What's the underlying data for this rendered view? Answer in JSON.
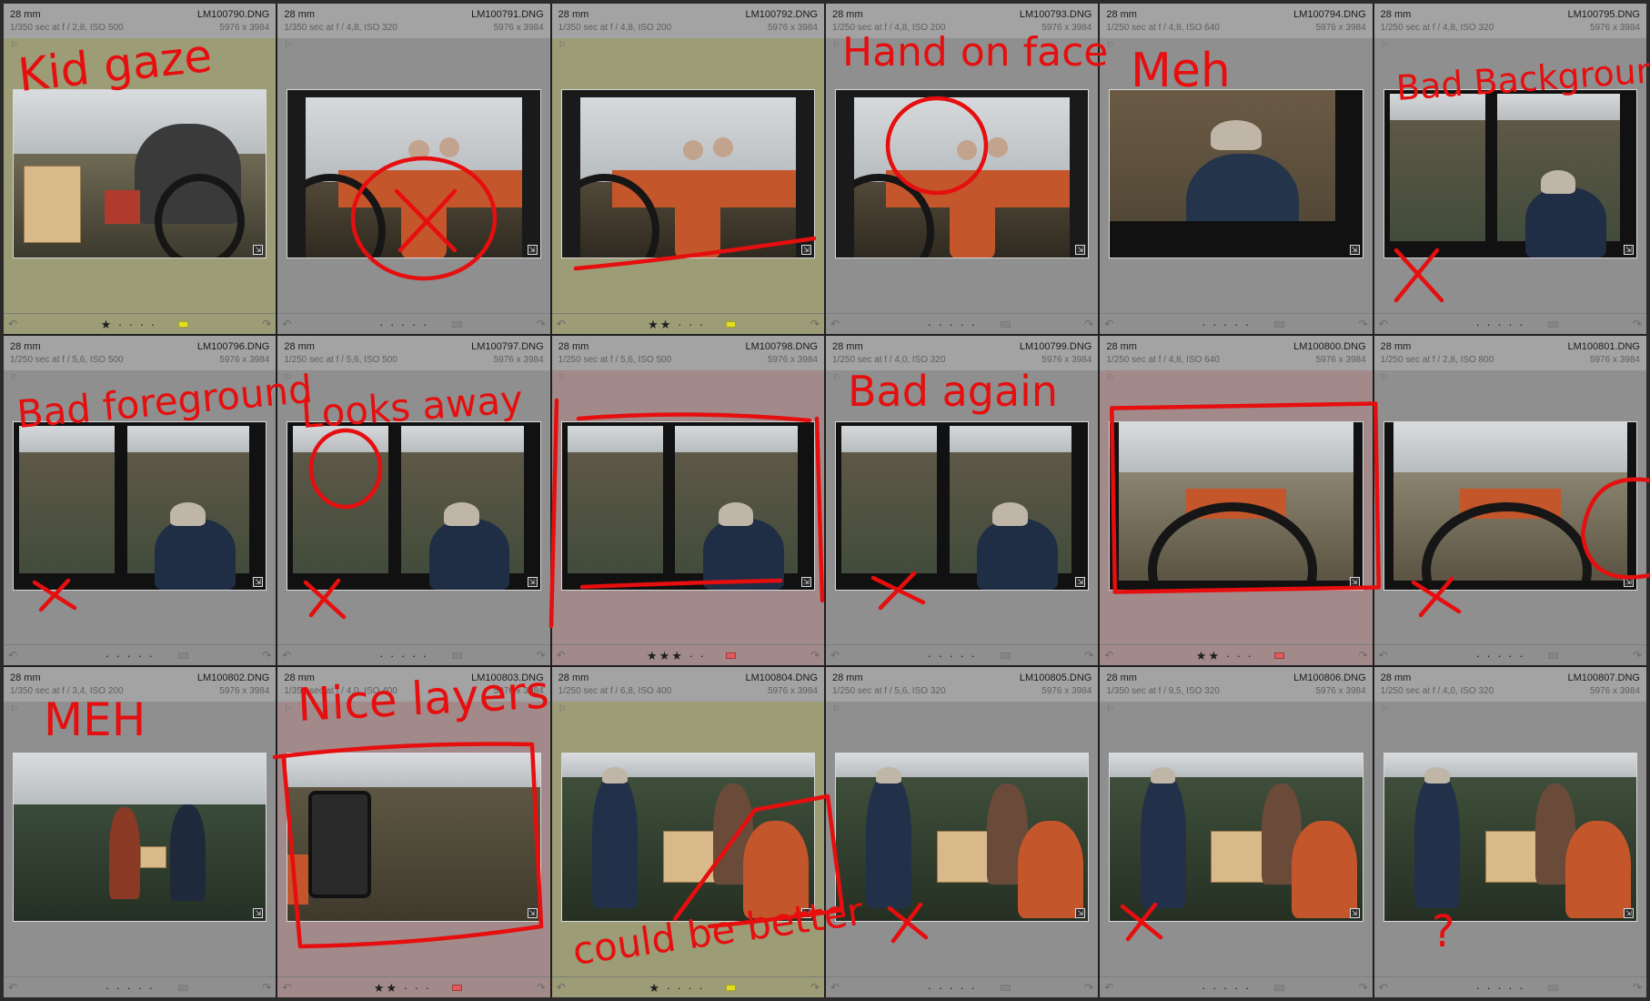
{
  "grid": {
    "cells": [
      {
        "focal": "28 mm",
        "filename": "LM100790.DNG",
        "exif": "1/350 sec at f / 2,8, ISO 500",
        "dims": "5976 x 3984",
        "stars": "★ · · · ·",
        "label": "yellow",
        "flag": "yellow",
        "scene": "tractor-crates"
      },
      {
        "focal": "28 mm",
        "filename": "LM100791.DNG",
        "exif": "1/350 sec at f / 4,8, ISO 320",
        "dims": "5976 x 3984",
        "stars": "· · · · ·",
        "label": "none",
        "flag": "none",
        "scene": "tractor-red"
      },
      {
        "focal": "28 mm",
        "filename": "LM100792.DNG",
        "exif": "1/350 sec at f / 4,8, ISO 200",
        "dims": "5976 x 3984",
        "stars": "★★ · · ·",
        "label": "yellow",
        "flag": "yellow",
        "scene": "tractor-red"
      },
      {
        "focal": "28 mm",
        "filename": "LM100793.DNG",
        "exif": "1/250 sec at f / 4,8, ISO 200",
        "dims": "5976 x 3984",
        "stars": "· · · · ·",
        "label": "none",
        "flag": "none",
        "scene": "tractor-red"
      },
      {
        "focal": "28 mm",
        "filename": "LM100794.DNG",
        "exif": "1/250 sec at f / 4,8, ISO 640",
        "dims": "5976 x 3984",
        "stars": "· · · · ·",
        "label": "none",
        "flag": "none",
        "scene": "man-field"
      },
      {
        "focal": "28 mm",
        "filename": "LM100795.DNG",
        "exif": "1/250 sec at f / 4,8, ISO 320",
        "dims": "5976 x 3984",
        "stars": "· · · · ·",
        "label": "none",
        "flag": "none",
        "scene": "cab-window"
      },
      {
        "focal": "28 mm",
        "filename": "LM100796.DNG",
        "exif": "1/250 sec at f / 5,6, ISO 500",
        "dims": "5976 x 3984",
        "stars": "· · · · ·",
        "label": "none",
        "flag": "none",
        "scene": "cab-window"
      },
      {
        "focal": "28 mm",
        "filename": "LM100797.DNG",
        "exif": "1/250 sec at f / 5,6, ISO 500",
        "dims": "5976 x 3984",
        "stars": "· · · · ·",
        "label": "none",
        "flag": "none",
        "scene": "cab-window"
      },
      {
        "focal": "28 mm",
        "filename": "LM100798.DNG",
        "exif": "1/250 sec at f / 5,6, ISO 500",
        "dims": "5976 x 3984",
        "stars": "★★★ · ·",
        "label": "red",
        "flag": "red",
        "scene": "cab-window"
      },
      {
        "focal": "28 mm",
        "filename": "LM100799.DNG",
        "exif": "1/250 sec at f / 4,0, ISO 320",
        "dims": "5976 x 3984",
        "stars": "· · · · ·",
        "label": "none",
        "flag": "none",
        "scene": "cab-window"
      },
      {
        "focal": "28 mm",
        "filename": "LM100800.DNG",
        "exif": "1/250 sec at f / 4,8, ISO 640",
        "dims": "5976 x 3984",
        "stars": "★★ · · ·",
        "label": "red",
        "flag": "red",
        "scene": "steering"
      },
      {
        "focal": "28 mm",
        "filename": "LM100801.DNG",
        "exif": "1/250 sec at f / 2,8, ISO 800",
        "dims": "5976 x 3984",
        "stars": "· · · · ·",
        "label": "none",
        "flag": "none",
        "scene": "steering"
      },
      {
        "focal": "28 mm",
        "filename": "LM100802.DNG",
        "exif": "1/350 sec at f / 3,4, ISO 200",
        "dims": "5976 x 3984",
        "stars": "· · · · ·",
        "label": "none",
        "flag": "none",
        "scene": "two-people"
      },
      {
        "focal": "28 mm",
        "filename": "LM100803.DNG",
        "exif": "1/350 sec at f / 4,0, ISO 400",
        "dims": "5976 x 3984",
        "stars": "★★ · · ·",
        "label": "red",
        "flag": "red",
        "scene": "mirror-field"
      },
      {
        "focal": "28 mm",
        "filename": "LM100804.DNG",
        "exif": "1/250 sec at f / 6,8, ISO 400",
        "dims": "5976 x 3984",
        "stars": "★ · · · ·",
        "label": "yellow",
        "flag": "yellow",
        "scene": "crates-people"
      },
      {
        "focal": "28 mm",
        "filename": "LM100805.DNG",
        "exif": "1/250 sec at f / 5,6, ISO 320",
        "dims": "5976 x 3984",
        "stars": "· · · · ·",
        "label": "none",
        "flag": "none",
        "scene": "crates-people"
      },
      {
        "focal": "28 mm",
        "filename": "LM100806.DNG",
        "exif": "1/350 sec at f / 9,5, ISO 320",
        "dims": "5976 x 3984",
        "stars": "· · · · ·",
        "label": "none",
        "flag": "none",
        "scene": "crates-people"
      },
      {
        "focal": "28 mm",
        "filename": "LM100807.DNG",
        "exif": "1/250 sec at f / 4,0, ISO 320",
        "dims": "5976 x 3984",
        "stars": "· · · · ·",
        "label": "none",
        "flag": "none",
        "scene": "crates-people"
      }
    ]
  },
  "annotations": {
    "labels": [
      "Kid gaze",
      "Hand on face",
      "Meh",
      "Bad Background",
      "Bad foreground",
      "Looks away",
      "Bad again",
      "MEH",
      "Nice layers",
      "could be better",
      "?"
    ],
    "marks": [
      "x",
      "x",
      "x",
      "x",
      "x",
      "x",
      "x",
      "x"
    ]
  },
  "colors": {
    "ink": "#e60e0e",
    "cell_gray": "#8f8f8f",
    "cell_yellow": "#9c9c76",
    "cell_red": "#a38a8a",
    "label_yellow": "#e2de28",
    "label_red": "#e25b5b"
  },
  "icons": {
    "expand": "expand-icon",
    "flag": "flag-icon",
    "rotate_left": "rotate-left-icon",
    "rotate_right": "rotate-right-icon"
  }
}
